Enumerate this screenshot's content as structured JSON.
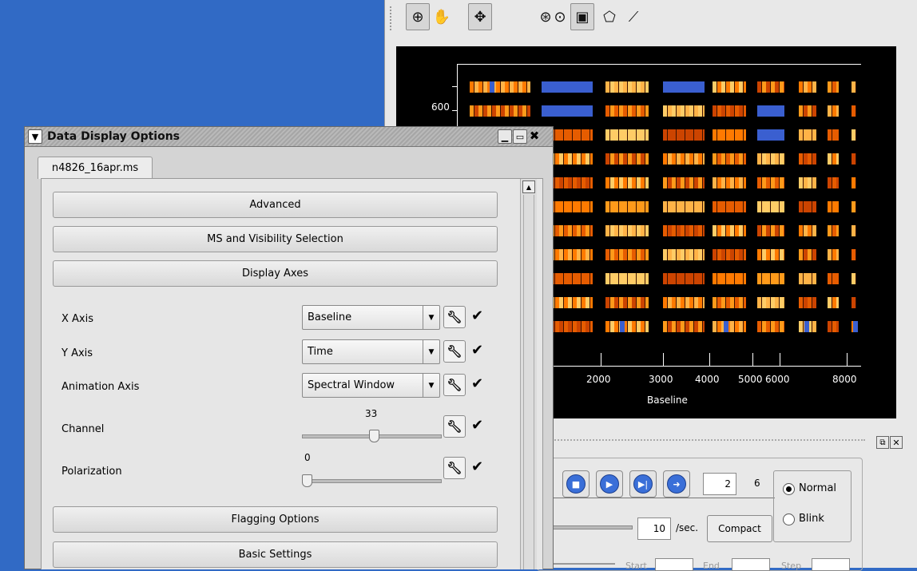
{
  "viewer": {
    "toolbar": [
      {
        "icon": "zoom-icon",
        "glyph": "⊕",
        "active": true
      },
      {
        "icon": "pan-icon",
        "glyph": "✋",
        "active": false
      },
      {
        "icon": "move-icon",
        "glyph": "✥",
        "active": true
      },
      {
        "icon": "crosshair-icon",
        "glyph": "⊛",
        "active": false
      },
      {
        "icon": "point-icon",
        "glyph": "⊙",
        "active": false
      },
      {
        "icon": "rectangle-region-icon",
        "glyph": "▣",
        "active": true
      },
      {
        "icon": "polygon-region-icon",
        "glyph": "⬠",
        "active": false
      },
      {
        "icon": "polyline-icon",
        "glyph": "⟋",
        "active": false
      }
    ],
    "plot": {
      "y_tick_label": "600",
      "x_tick_labels": [
        "2000",
        "3000",
        "4000",
        "5000",
        "6000",
        "8000"
      ],
      "x_axis_label": "Baseline"
    },
    "animator": {
      "frame_value": "2",
      "frame_total": "6",
      "rate_value": "10",
      "rate_unit": "/sec.",
      "compact_label": "Compact",
      "mode_normal": "Normal",
      "mode_blink": "Blink",
      "mode_selected": "Normal",
      "start_label": "Start",
      "end_label": "End",
      "step_label": "Step"
    }
  },
  "dialog": {
    "title": "Data Display Options",
    "tab": "n4826_16apr.ms",
    "sections": {
      "advanced": "Advanced",
      "ms_selection": "MS and Visibility Selection",
      "display_axes": "Display Axes",
      "flagging": "Flagging Options",
      "basic": "Basic Settings"
    },
    "x_axis": {
      "label": "X Axis",
      "value": "Baseline"
    },
    "y_axis": {
      "label": "Y Axis",
      "value": "Time"
    },
    "animation_axis": {
      "label": "Animation Axis",
      "value": "Spectral Window"
    },
    "channel": {
      "label": "Channel",
      "value": "33",
      "fraction": 0.52
    },
    "polarization": {
      "label": "Polarization",
      "value": "0",
      "fraction": 0.0
    }
  }
}
